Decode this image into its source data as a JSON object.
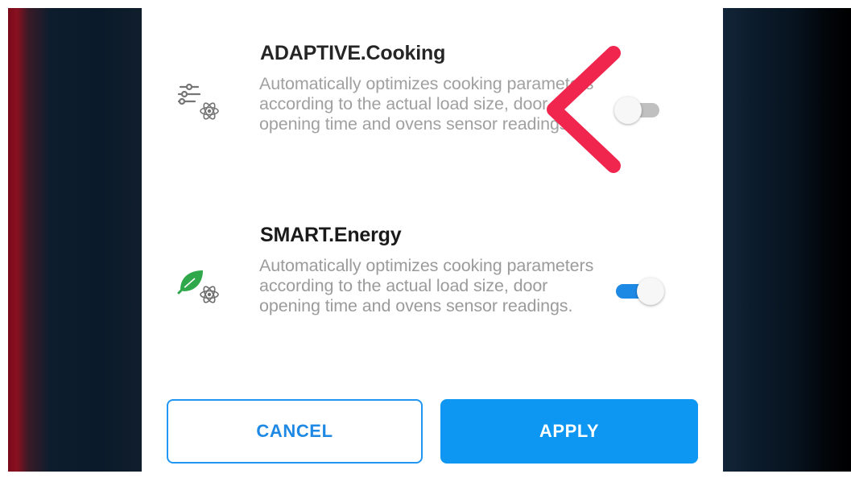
{
  "settings": [
    {
      "id": "adaptive",
      "title": "ADAPTIVE.Cooking",
      "description": "Automatically optimizes cooking parameters according to the actual load size, door opening time and ovens sensor readings.",
      "icon": "sliders-atom-icon",
      "enabled": false
    },
    {
      "id": "energy",
      "title": "SMART.Energy",
      "description": "Automatically optimizes cooking parameters according to the actual load size, door opening time and ovens sensor readings.",
      "icon": "leaf-atom-icon",
      "enabled": true
    }
  ],
  "buttons": {
    "cancel": "CANCEL",
    "apply": "APPLY"
  },
  "annotation": {
    "icon": "red-arrow-icon",
    "color": "#f0264f"
  },
  "colors": {
    "accent": "#0d96f2",
    "toggle_on": "#1e88e5",
    "leaf": "#2ea84a"
  }
}
